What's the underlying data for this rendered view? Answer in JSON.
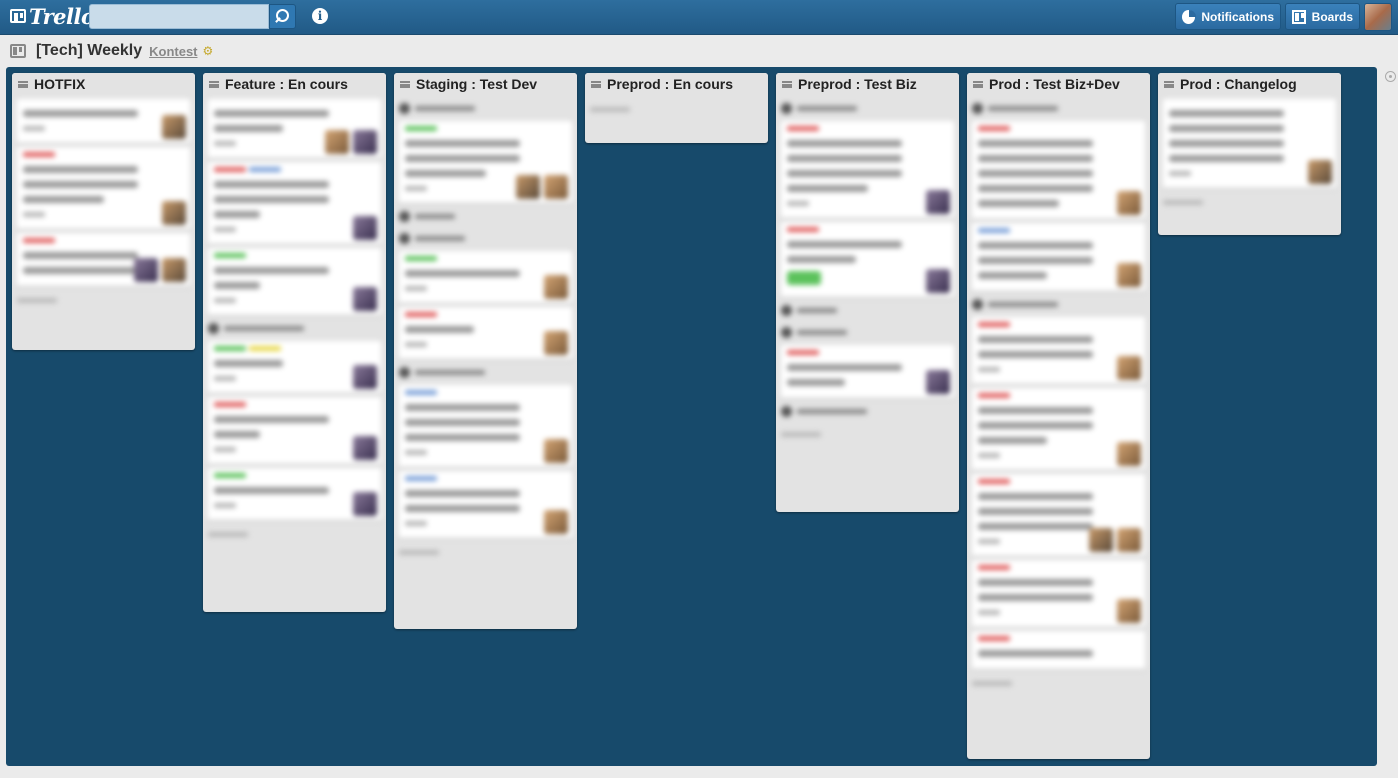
{
  "app": {
    "logo_text": "Trello"
  },
  "header": {
    "search": {
      "value": "",
      "placeholder": ""
    },
    "notifications_label": "Notifications",
    "boards_label": "Boards"
  },
  "board": {
    "title": "[Tech] Weekly",
    "organization": "Kontest"
  },
  "colors": {
    "header": "#215a86",
    "board_bg": "#174a6b",
    "list_bg": "#e3e3e3",
    "label_red": "#e06060",
    "label_blue": "#7aa0d8",
    "label_green": "#5cc25c",
    "label_yellow": "#e8d84a"
  },
  "lists": [
    {
      "title": "HOTFIX",
      "height": 277,
      "items": [
        {
          "t": "card",
          "labels": [],
          "lines": [
            1
          ],
          "badge": true,
          "av": 1
        },
        {
          "t": "card",
          "labels": [
            "red"
          ],
          "lines": [
            1,
            1,
            0.7
          ],
          "badge": true,
          "av": 1
        },
        {
          "t": "card",
          "labels": [
            "red"
          ],
          "lines": [
            1,
            1
          ],
          "badge": false,
          "av": 2
        }
      ]
    },
    {
      "title": "Feature : En cours",
      "height": 539,
      "items": [
        {
          "t": "card",
          "labels": [],
          "lines": [
            1,
            0.6
          ],
          "badge": true,
          "av": 2
        },
        {
          "t": "card",
          "labels": [
            "red",
            "blue"
          ],
          "lines": [
            1,
            1,
            0.4
          ],
          "badge": true,
          "av": 1
        },
        {
          "t": "card",
          "labels": [
            "green"
          ],
          "lines": [
            1,
            0.4
          ],
          "badge": true,
          "av": 1
        },
        {
          "t": "sep",
          "w": 80
        },
        {
          "t": "card",
          "labels": [
            "green",
            "yellow"
          ],
          "lines": [
            0.6
          ],
          "badge": true,
          "av": 1
        },
        {
          "t": "card",
          "labels": [
            "red"
          ],
          "lines": [
            1,
            0.4
          ],
          "badge": true,
          "av": 1
        },
        {
          "t": "card",
          "labels": [
            "green"
          ],
          "lines": [
            1
          ],
          "badge": true,
          "av": 1
        }
      ]
    },
    {
      "title": "Staging : Test Dev",
      "height": 556,
      "items": [
        {
          "t": "sep",
          "w": 60
        },
        {
          "t": "card",
          "labels": [
            "green"
          ],
          "lines": [
            1,
            1,
            0.7
          ],
          "badge": true,
          "av": 2
        },
        {
          "t": "sep",
          "w": 40
        },
        {
          "t": "sep",
          "w": 50
        },
        {
          "t": "card",
          "labels": [
            "green"
          ],
          "lines": [
            1
          ],
          "badge": true,
          "av": 1
        },
        {
          "t": "card",
          "labels": [
            "red"
          ],
          "lines": [
            0.6
          ],
          "badge": true,
          "av": 1
        },
        {
          "t": "sep",
          "w": 70
        },
        {
          "t": "card",
          "labels": [
            "blue"
          ],
          "lines": [
            1,
            1,
            1
          ],
          "badge": true,
          "av": 1
        },
        {
          "t": "card",
          "labels": [
            "blue"
          ],
          "lines": [
            1,
            1
          ],
          "badge": true,
          "av": 1
        }
      ]
    },
    {
      "title": "Preprod : En cours",
      "height": 70,
      "items": []
    },
    {
      "title": "Preprod : Test Biz",
      "height": 439,
      "items": [
        {
          "t": "sep",
          "w": 60
        },
        {
          "t": "card",
          "labels": [
            "red"
          ],
          "lines": [
            1,
            1,
            1,
            0.7
          ],
          "badge": true,
          "av": 1
        },
        {
          "t": "card",
          "labels": [
            "red"
          ],
          "lines": [
            1,
            0.6
          ],
          "badge": false,
          "green": true,
          "av": 1
        },
        {
          "t": "sep",
          "w": 40
        },
        {
          "t": "sep",
          "w": 50
        },
        {
          "t": "card",
          "labels": [
            "red"
          ],
          "lines": [
            1,
            0.5
          ],
          "badge": false,
          "av": 1
        },
        {
          "t": "sep",
          "w": 70
        }
      ]
    },
    {
      "title": "Prod : Test Biz+Dev",
      "height": 686,
      "items": [
        {
          "t": "sep",
          "w": 70
        },
        {
          "t": "card",
          "labels": [
            "red"
          ],
          "lines": [
            1,
            1,
            1,
            1,
            0.7
          ],
          "badge": false,
          "av": 1
        },
        {
          "t": "card",
          "labels": [
            "blue"
          ],
          "lines": [
            1,
            1,
            0.6
          ],
          "badge": false,
          "av": 1
        },
        {
          "t": "sep",
          "w": 70
        },
        {
          "t": "card",
          "labels": [
            "red"
          ],
          "lines": [
            1,
            1
          ],
          "badge": true,
          "av": 1
        },
        {
          "t": "card",
          "labels": [
            "red"
          ],
          "lines": [
            1,
            1,
            0.6
          ],
          "badge": true,
          "av": 1
        },
        {
          "t": "card",
          "labels": [
            "red"
          ],
          "lines": [
            1,
            1,
            1
          ],
          "badge": true,
          "av": 2
        },
        {
          "t": "card",
          "labels": [
            "red"
          ],
          "lines": [
            1,
            1
          ],
          "badge": true,
          "av": 1
        },
        {
          "t": "card",
          "labels": [
            "red"
          ],
          "lines": [
            1
          ],
          "badge": false,
          "av": 0
        }
      ]
    },
    {
      "title": "Prod : Changelog",
      "height": 162,
      "items": [
        {
          "t": "card",
          "labels": [],
          "lines": [
            1,
            1,
            1,
            1
          ],
          "badge": true,
          "av": 1
        }
      ]
    }
  ]
}
